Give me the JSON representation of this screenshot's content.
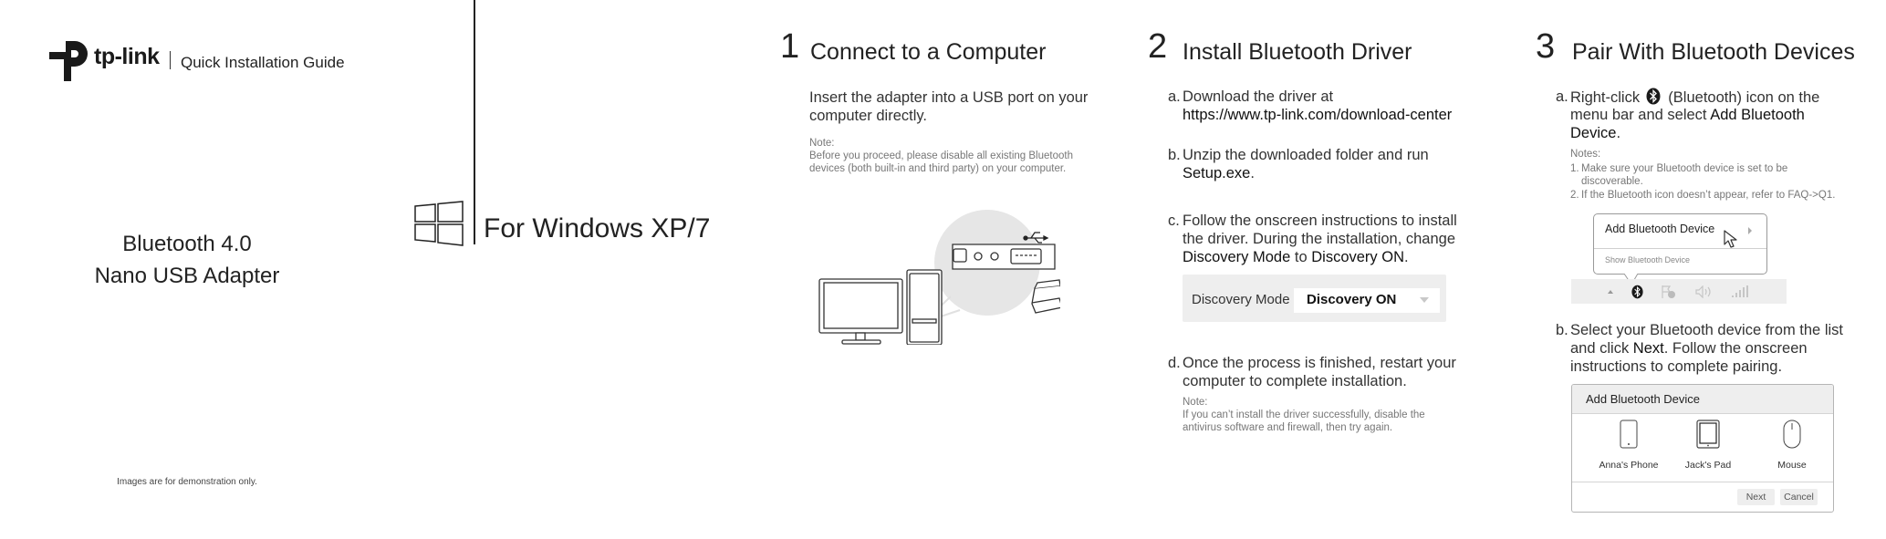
{
  "cover": {
    "brand": "tp-link",
    "guide_title": "Quick Installation Guide",
    "product_line1": "Bluetooth 4.0",
    "product_line2": "Nano USB Adapter",
    "platform_label": "For Windows XP/7",
    "disclaimer": "Images are for demonstration only.",
    "icons": {
      "brand_logo": "tp-link-logo",
      "os_logo": "windows-logo"
    }
  },
  "step1": {
    "number": "1",
    "title": "Connect to a Computer",
    "text_line1": "Insert the adapter into a USB port on your",
    "text_line2": "computer directly.",
    "note_label": "Note:",
    "note_line1": "Before you proceed, please disable all existing Bluetooth",
    "note_line2": "devices (both built-in and third party) on your computer.",
    "illustration": "computer-usb-adapter-illustration"
  },
  "step2": {
    "number": "2",
    "title": "Install Bluetooth Driver",
    "items": [
      {
        "label": "a.",
        "line1": "Download the driver at",
        "line2": "https://www.tp-link.com/download-center"
      },
      {
        "label": "b.",
        "line1": "Unzip the downloaded folder and run",
        "line2": "Setup.exe",
        "line2_suffix": "."
      },
      {
        "label": "c.",
        "line1": "Follow the onscreen instructions to install",
        "line2": "the driver. During the installation, change",
        "line3_bold1": "Discovery Mode",
        "line3_mid": " to ",
        "line3_bold2": "Discovery ON",
        "line3_end": "."
      },
      {
        "label": "d.",
        "line1": "Once the process is finished, restart your",
        "line2": "computer to complete installation."
      }
    ],
    "dropdown": {
      "label": "Discovery Mode",
      "selected": "Discovery ON"
    },
    "note_label": "Note:",
    "note_line1": "If you can’t install the driver successfully, disable the",
    "note_line2": "antivirus software and firewall, then try again."
  },
  "step3": {
    "number": "3",
    "title": "Pair With Bluetooth Devices",
    "a": {
      "label": "a.",
      "line1_pre": "Right-click",
      "line1_post": "(Bluetooth) icon on the",
      "line2_pre": "menu bar and select ",
      "line2_bold": "Add Bluetooth",
      "line3_bold": "Device",
      "line3_end": "."
    },
    "notes_label": "Notes:",
    "notes": [
      {
        "num": "1.",
        "line1": "Make sure your Bluetooth device is set to be",
        "line2": "discoverable."
      },
      {
        "num": "2.",
        "line1": "If the Bluetooth icon doesn’t appear, refer to FAQ->Q1."
      }
    ],
    "context_menu": {
      "items": [
        "Add Bluetooth Device",
        "Show Bluetooth Device"
      ]
    },
    "tray_icons": [
      "show-hidden-arrow-icon",
      "bluetooth-icon",
      "action-center-flag-icon",
      "volume-icon",
      "signal-bars-icon"
    ],
    "b": {
      "label": "b.",
      "line1": "Select your Bluetooth device from the list",
      "line2_pre": "and click ",
      "line2_bold": "Next",
      "line2_post": ". Follow the onscreen",
      "line3": "instructions to complete pairing."
    },
    "dialog": {
      "title": "Add Bluetooth Device",
      "devices": [
        {
          "name": "Anna's Phone",
          "icon": "phone-icon"
        },
        {
          "name": "Jack's Pad",
          "icon": "tablet-icon"
        },
        {
          "name": "Mouse",
          "icon": "mouse-icon"
        }
      ],
      "next_label": "Next",
      "cancel_label": "Cancel"
    }
  }
}
